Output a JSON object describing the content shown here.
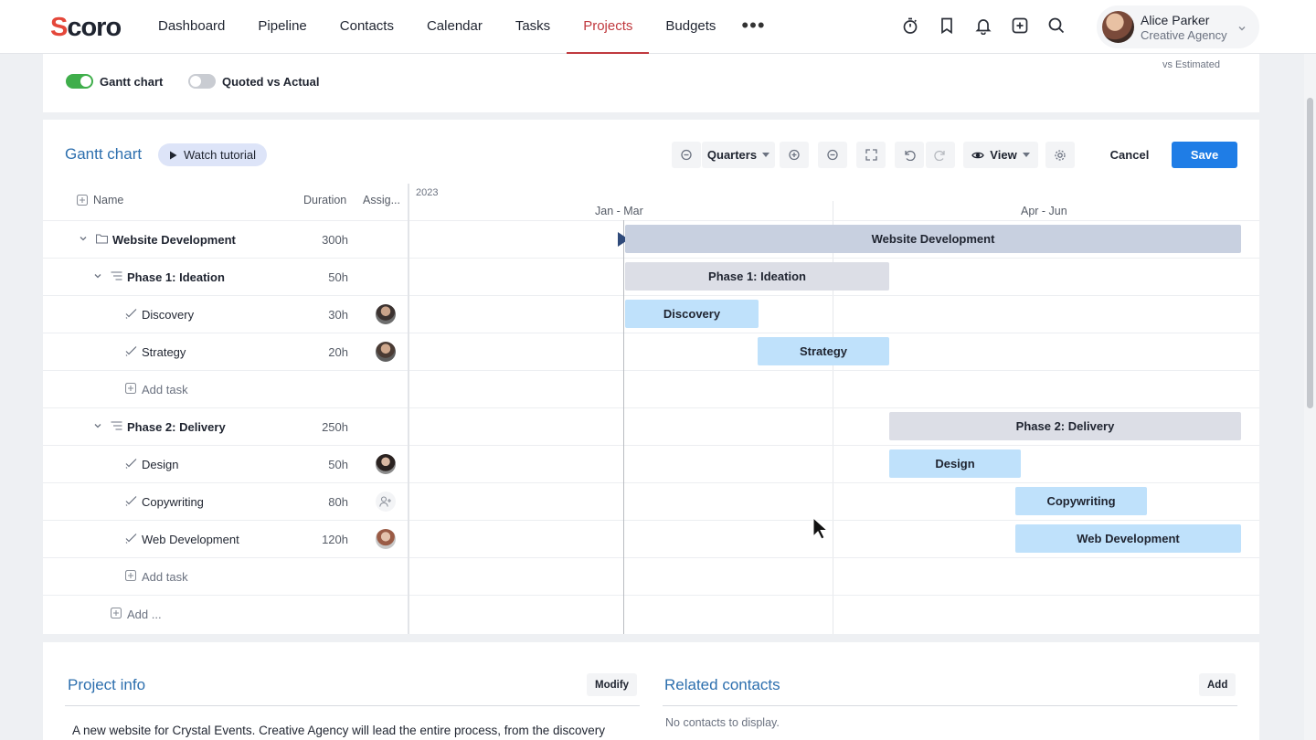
{
  "app": {
    "logo": "Scoro"
  },
  "nav": {
    "items": [
      "Dashboard",
      "Pipeline",
      "Contacts",
      "Calendar",
      "Tasks",
      "Projects",
      "Budgets"
    ],
    "active": "Projects",
    "more": "•••"
  },
  "user": {
    "name": "Alice Parker",
    "org": "Creative Agency"
  },
  "toggles": {
    "gantt": {
      "label": "Gantt chart",
      "on": true
    },
    "quoted": {
      "label": "Quoted vs Actual",
      "on": false
    },
    "vs_estimated": "vs Estimated"
  },
  "gantt": {
    "title": "Gantt chart",
    "watch_tutorial": "Watch tutorial",
    "scale": "Quarters",
    "view": "View",
    "cancel": "Cancel",
    "save": "Save",
    "columns": {
      "name": "Name",
      "duration": "Duration",
      "assignee": "Assig..."
    },
    "year": "2023",
    "quarters": [
      "Jan - Mar",
      "Apr - Jun"
    ],
    "rows": [
      {
        "name": "Website Development",
        "duration": "300h",
        "kind": "project"
      },
      {
        "name": "Phase 1: Ideation",
        "duration": "50h",
        "kind": "phase"
      },
      {
        "name": "Discovery",
        "duration": "30h",
        "kind": "task"
      },
      {
        "name": "Strategy",
        "duration": "20h",
        "kind": "task"
      },
      {
        "name": "Add task",
        "kind": "add"
      },
      {
        "name": "Phase 2: Delivery",
        "duration": "250h",
        "kind": "phase"
      },
      {
        "name": "Design",
        "duration": "50h",
        "kind": "task"
      },
      {
        "name": "Copywriting",
        "duration": "80h",
        "kind": "task"
      },
      {
        "name": "Web Development",
        "duration": "120h",
        "kind": "task"
      },
      {
        "name": "Add task",
        "kind": "add"
      },
      {
        "name": "Add ...",
        "kind": "add-root"
      }
    ]
  },
  "project_info": {
    "title": "Project info",
    "modify": "Modify",
    "description": "A new website for Crystal Events. Creative Agency will lead the entire process, from the discovery"
  },
  "related_contacts": {
    "title": "Related contacts",
    "add": "Add",
    "empty": "No contacts to display."
  },
  "colors": {
    "accent_nav": "#c0393e",
    "primary_button": "#1f7de6",
    "toggle_on": "#3fae4b",
    "title_blue": "#2d6fae"
  }
}
